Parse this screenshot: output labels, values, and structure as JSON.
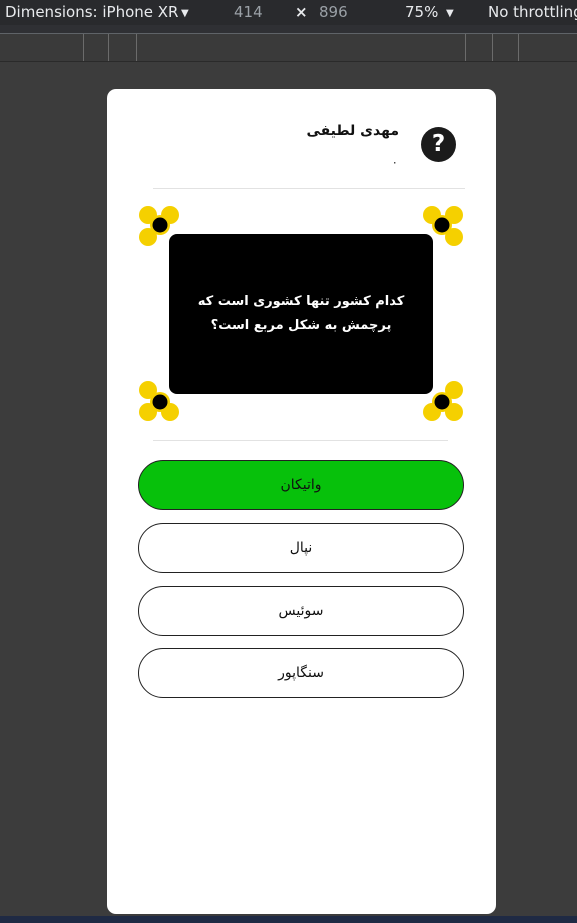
{
  "devtools": {
    "device_label": "Dimensions: iPhone XR",
    "width": "414",
    "times": "×",
    "height": "896",
    "zoom": "75%",
    "throttling": "No throttling"
  },
  "user": {
    "name": "مهدی لطیفی",
    "score": "۰"
  },
  "help_symbol": "?",
  "question": {
    "text": "کدام کشور تنها کشوری است که پرچمش به شکل مربع است؟"
  },
  "answers": [
    {
      "label": "واتیکان",
      "state": "correct"
    },
    {
      "label": "نپال",
      "state": "default"
    },
    {
      "label": "سوئیس",
      "state": "default"
    },
    {
      "label": "سنگاپور",
      "state": "default"
    }
  ],
  "colors": {
    "correct": "#07c10b",
    "corner_accent": "#f5d000",
    "question_bg": "#000000"
  }
}
